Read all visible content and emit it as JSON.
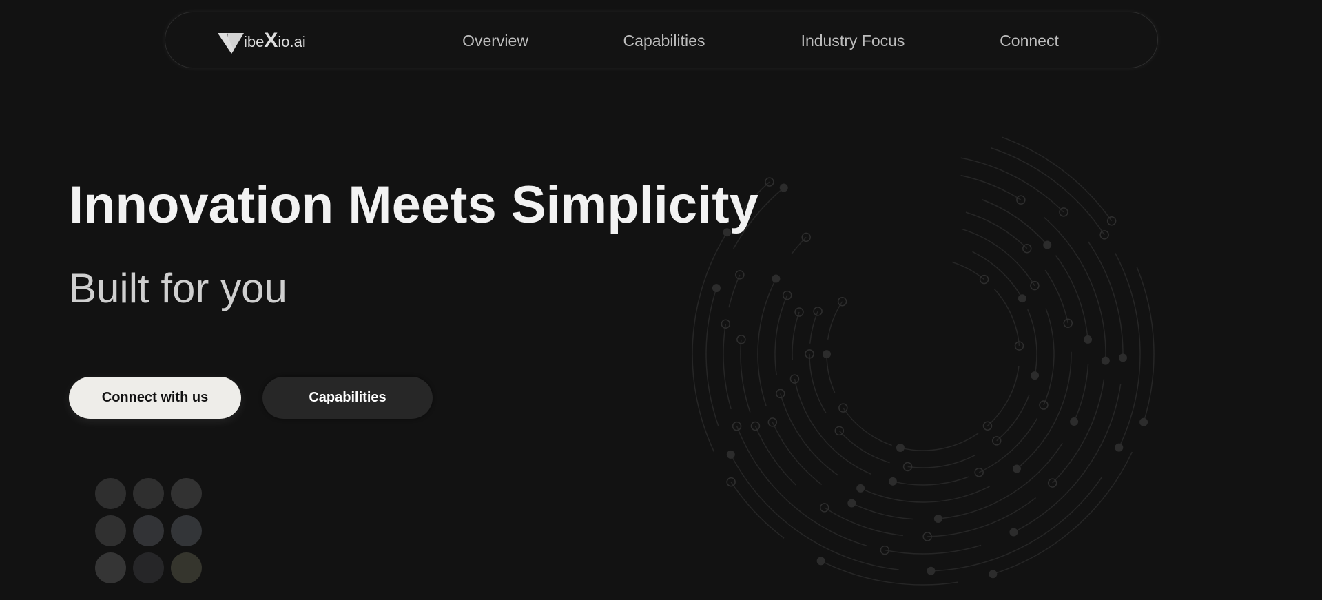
{
  "nav": {
    "logo_text": "VibeXio.ai",
    "links": [
      {
        "label": "Overview"
      },
      {
        "label": "Capabilities"
      },
      {
        "label": "Industry Focus"
      },
      {
        "label": "Connect"
      }
    ]
  },
  "hero": {
    "title": "Innovation Meets Simplicity",
    "subtitle": "Built for you",
    "primary_button": "Connect with us",
    "secondary_button": "Capabilities"
  },
  "colors": {
    "background": "#121212",
    "primary_button": "#eeede9",
    "secondary_button": "#272727",
    "dot_grid": [
      "#2f2f2f",
      "#2f2f2f",
      "#323232",
      "#303030",
      "#323336",
      "#333538",
      "#353535",
      "#262628",
      "#35352d"
    ]
  }
}
